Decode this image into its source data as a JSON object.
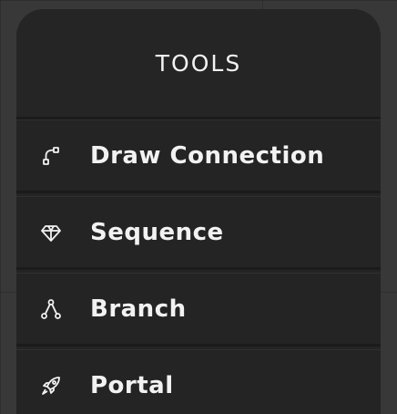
{
  "panel": {
    "title": "TOOLS"
  },
  "tools": [
    {
      "label": "Draw Connection",
      "icon": "connection-icon"
    },
    {
      "label": "Sequence",
      "icon": "diamond-icon"
    },
    {
      "label": "Branch",
      "icon": "branch-icon"
    },
    {
      "label": "Portal",
      "icon": "rocket-icon"
    }
  ],
  "colors": {
    "panel_bg": "#242424",
    "text": "#f2f2f2",
    "canvas_bg": "#383838"
  }
}
